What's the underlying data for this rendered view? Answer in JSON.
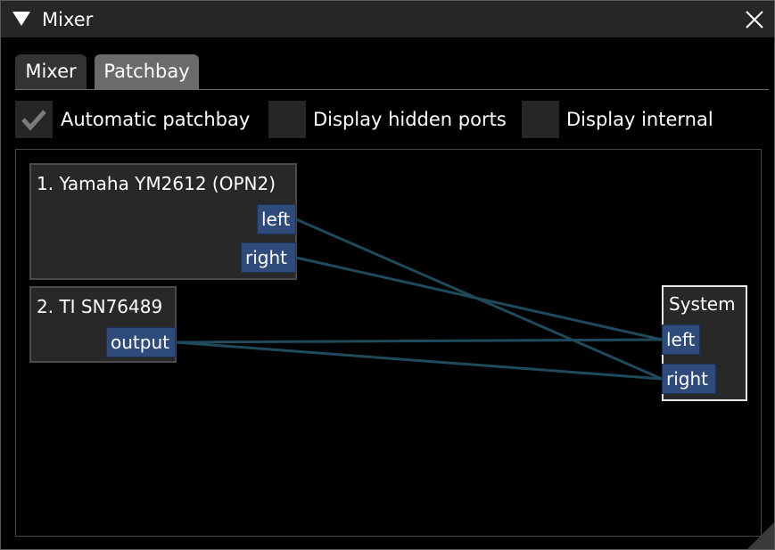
{
  "window": {
    "title": "Mixer"
  },
  "tabs": [
    {
      "label": "Mixer",
      "active": false
    },
    {
      "label": "Patchbay",
      "active": true
    }
  ],
  "options": [
    {
      "label": "Automatic patchbay",
      "checked": true
    },
    {
      "label": "Display hidden ports",
      "checked": false
    },
    {
      "label": "Display internal",
      "checked": false
    }
  ],
  "nodes": {
    "ym2612": {
      "title": "1. Yamaha YM2612 (OPN2)",
      "ports": [
        "left",
        "right"
      ]
    },
    "sn76489": {
      "title": "2. TI SN76489",
      "ports": [
        "output"
      ]
    },
    "system": {
      "title": "System",
      "ports": [
        "left",
        "right"
      ]
    }
  },
  "colors": {
    "port": "#2f4b7c",
    "wire": "#1e4a5c",
    "node": "#282828",
    "tab_active": "#6b6b6b"
  },
  "icons": {
    "collapse": "triangle-down-icon",
    "close": "close-icon",
    "check": "checkmark-icon",
    "resize": "resize-grip-icon"
  }
}
